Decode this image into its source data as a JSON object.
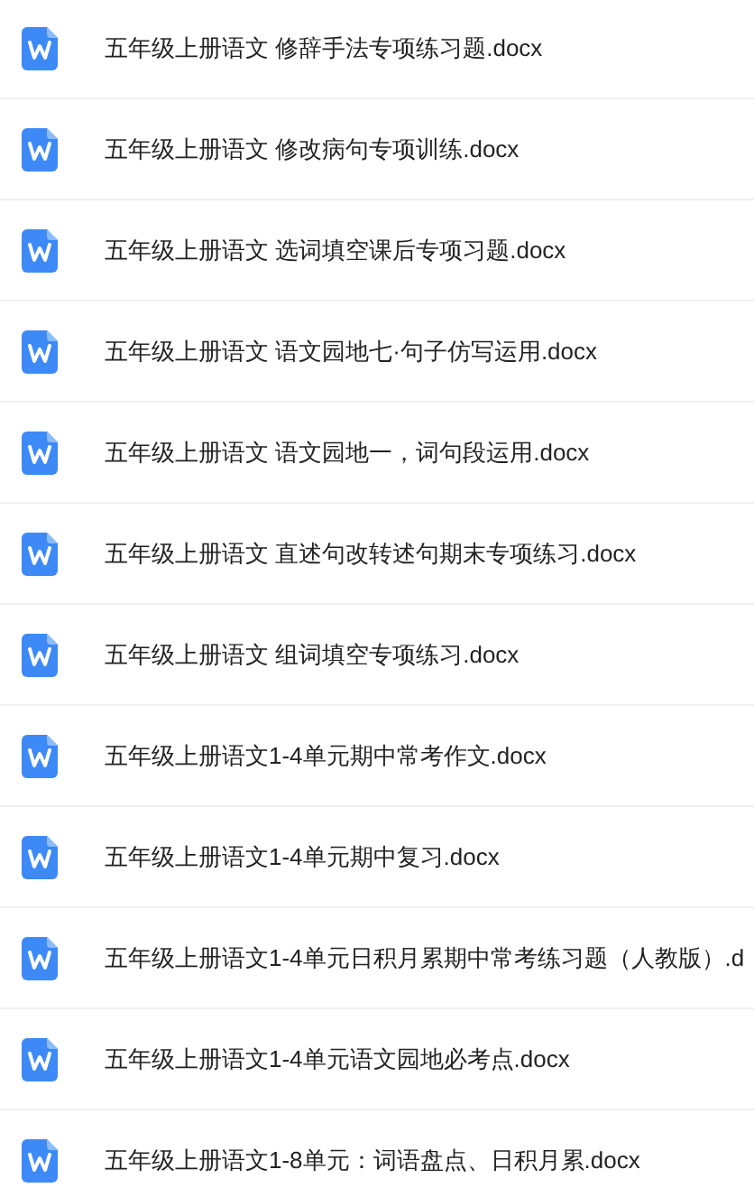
{
  "files": [
    {
      "name": "五年级上册语文 修辞手法专项练习题.docx"
    },
    {
      "name": "五年级上册语文 修改病句专项训练.docx"
    },
    {
      "name": "五年级上册语文 选词填空课后专项习题.docx"
    },
    {
      "name": "五年级上册语文 语文园地七·句子仿写运用.docx"
    },
    {
      "name": "五年级上册语文 语文园地一，词句段运用.docx"
    },
    {
      "name": "五年级上册语文 直述句改转述句期末专项练习.docx"
    },
    {
      "name": "五年级上册语文 组词填空专项练习.docx"
    },
    {
      "name": "五年级上册语文1-4单元期中常考作文.docx"
    },
    {
      "name": "五年级上册语文1-4单元期中复习.docx"
    },
    {
      "name": "五年级上册语文1-4单元日积月累期中常考练习题（人教版）.d"
    },
    {
      "name": "五年级上册语文1-4单元语文园地必考点.docx"
    },
    {
      "name": "五年级上册语文1-8单元：词语盘点、日积月累.docx"
    }
  ]
}
